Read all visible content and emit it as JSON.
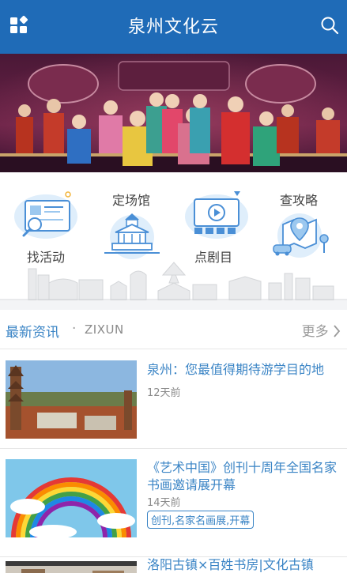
{
  "header": {
    "title": "泉州文化云",
    "menu_icon": "grid-menu-icon",
    "search_icon": "search-icon",
    "background": "#1f6bb7"
  },
  "quick_nav": [
    {
      "label": "找活动",
      "icon": "activity-screen-icon"
    },
    {
      "label": "定场馆",
      "icon": "venue-building-icon"
    },
    {
      "label": "点剧目",
      "icon": "play-video-icon"
    },
    {
      "label": "查攻略",
      "icon": "map-guide-icon"
    }
  ],
  "news": {
    "section_title": "最新资讯",
    "separator": "·",
    "section_subtitle": "ZIXUN",
    "more_label": "更多",
    "articles": [
      {
        "title": "泉州：您最值得期待游学目的地",
        "time": "12天前",
        "tag": ""
      },
      {
        "title": "《艺术中国》创刊十周年全国名家书画邀请展开幕",
        "time": "14天前",
        "tag": "创刊,名家名画展,开幕"
      },
      {
        "title": "洛阳古镇×百姓书房|文化古镇",
        "time": "",
        "tag": ""
      }
    ]
  },
  "colors": {
    "accent": "#3a84c5",
    "header_blue": "#1f6bb7",
    "muted": "#8a8a8a"
  }
}
